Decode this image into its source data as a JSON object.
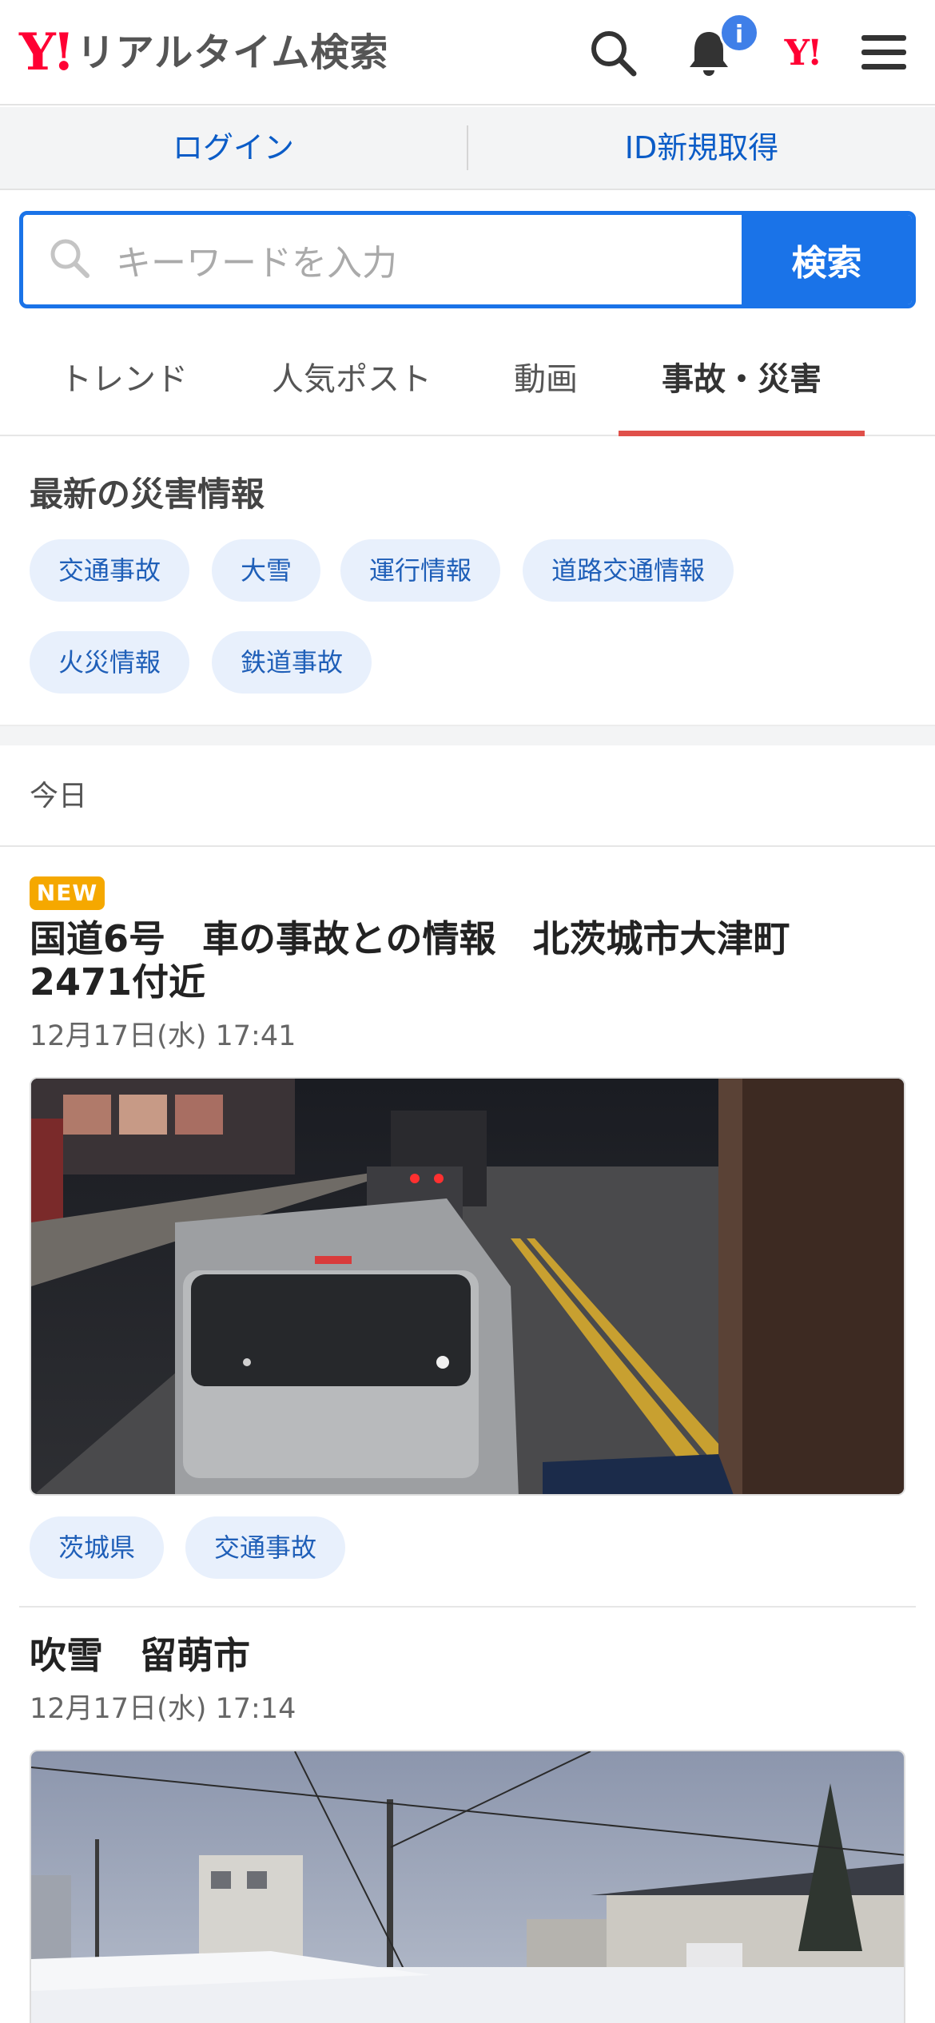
{
  "header": {
    "logo_mark": "Y!",
    "logo_text": "リアルタイム検索",
    "notification_badge": "i",
    "yahoo_mark": "Y!"
  },
  "login_bar": {
    "login": "ログイン",
    "register": "ID新規取得"
  },
  "search": {
    "placeholder": "キーワードを入力",
    "button": "検索"
  },
  "tabs": [
    {
      "label": "トレンド",
      "active": false
    },
    {
      "label": "人気ポスト",
      "active": false
    },
    {
      "label": "動画",
      "active": false
    },
    {
      "label": "事故・災害",
      "active": true
    }
  ],
  "disaster": {
    "title": "最新の災害情報",
    "chips": [
      "交通事故",
      "大雪",
      "運行情報",
      "道路交通情報",
      "火災情報",
      "鉄道事故"
    ]
  },
  "timeline": {
    "day_label": "今日"
  },
  "articles": [
    {
      "badge": "NEW",
      "title_line1": "国道6号　車の事故との情報　北茨城市大津町",
      "title_line2": "2471付近",
      "date": "12月17日(水) 17:41",
      "tags": [
        "茨城県",
        "交通事故"
      ]
    },
    {
      "title": "吹雪　留萌市",
      "date": "12月17日(水) 17:14"
    }
  ],
  "colors": {
    "brand_red": "#ff0033",
    "accent_blue": "#1a73e8",
    "link_blue": "#0b5cc7",
    "active_tab_underline": "#e0504a",
    "new_badge": "#f5a800",
    "chip_bg": "#e8f0fc"
  }
}
